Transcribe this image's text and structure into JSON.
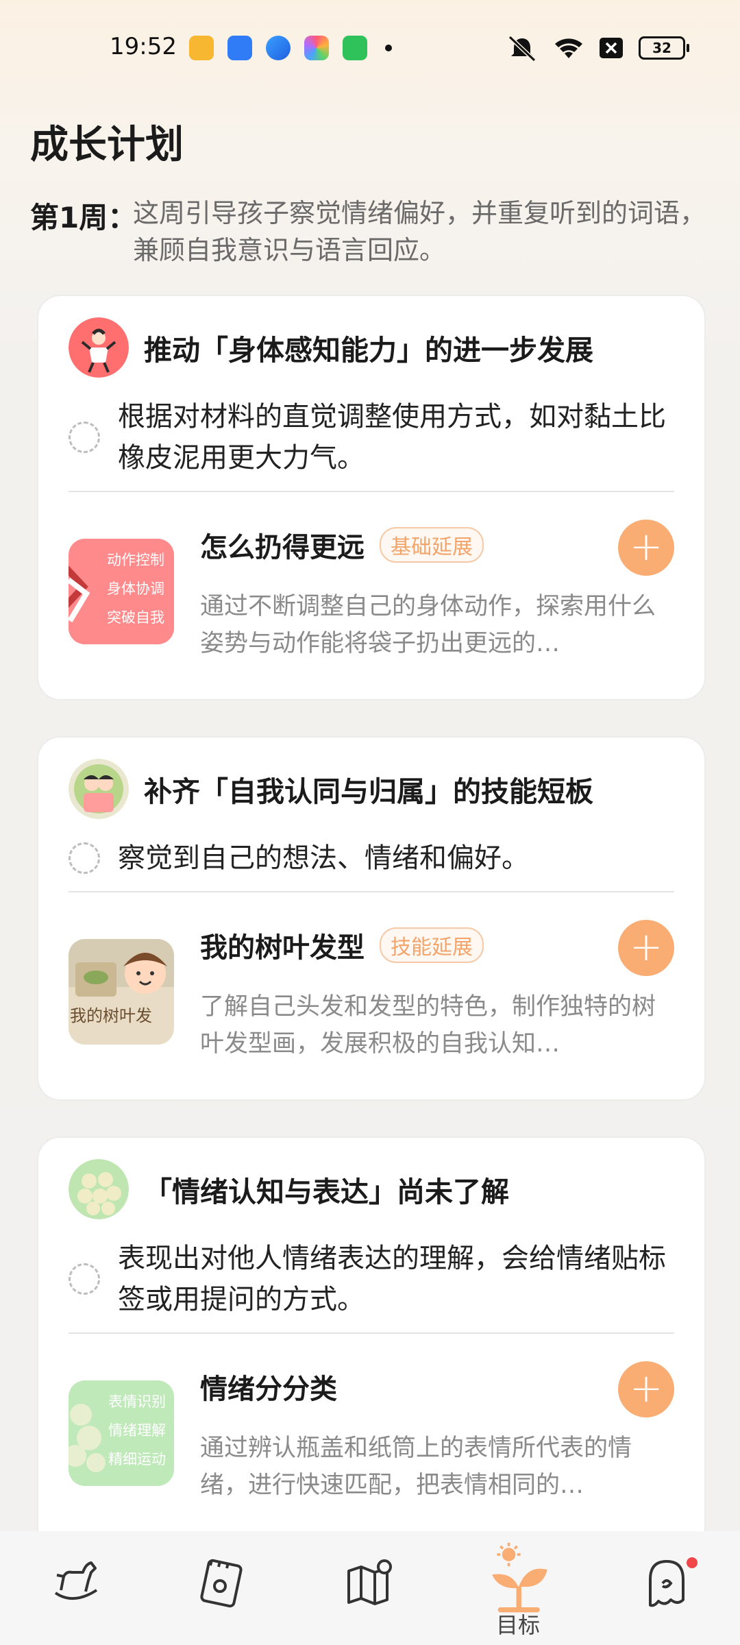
{
  "status_bar": {
    "time": "19:52",
    "battery": "32",
    "notification_icons": [
      "books-app-icon",
      "files-app-icon",
      "browser-app-icon",
      "gallery-app-icon",
      "wechat-app-icon"
    ],
    "system_icons": [
      "silent-icon",
      "wifi-icon",
      "sim-off-icon",
      "battery-icon"
    ]
  },
  "header": {
    "title": "成长计划"
  },
  "week": {
    "label": "第1周：",
    "description": "这周引导孩子察觉情绪偏好，并重复听到的词语，兼顾自我意识与语言回应。"
  },
  "goals": [
    {
      "title": "推动「身体感知能力」的进一步发展",
      "description": "根据对材料的直觉调整使用方式，如对黏土比橡皮泥用更大力气。",
      "activity": {
        "title": "怎么扔得更远",
        "badge": "基础延展",
        "description": "通过不断调整自己的身体动作，探索用什么姿势与动作能将袋子扔出更远的…",
        "thumb_lines": [
          "动作控制",
          "身体协调",
          "突破自我"
        ]
      }
    },
    {
      "title": "补齐「自我认同与归属」的技能短板",
      "description": "察觉到自己的想法、情绪和偏好。",
      "activity": {
        "title": "我的树叶发型",
        "badge": "技能延展",
        "description": "了解自己头发和发型的特色，制作独特的树叶发型画，发展积极的自我认知…",
        "thumb_lines": [
          "我的树叶发"
        ]
      }
    },
    {
      "title": "「情绪认知与表达」尚未了解",
      "description": "表现出对他人情绪表达的理解，会给情绪贴标签或用提问的方式。",
      "activity": {
        "title": "情绪分分类",
        "badge": "",
        "description": "通过辨认瓶盖和纸筒上的表情所代表的情绪，进行快速匹配，把表情相同的…",
        "thumb_lines": [
          "表情识别",
          "情绪理解",
          "精细运动"
        ]
      }
    }
  ],
  "add_label": "+",
  "tabs": [
    {
      "icon": "rocking-horse-icon",
      "label": ""
    },
    {
      "icon": "notebook-icon",
      "label": ""
    },
    {
      "icon": "map-icon",
      "label": ""
    },
    {
      "icon": "sprout-icon",
      "label": "目标"
    },
    {
      "icon": "ghost-profile-icon",
      "label": ""
    }
  ],
  "colors": {
    "accent": "#f9ad73",
    "badge_text": "#f3a46a",
    "notification_dot": "#f0464a"
  }
}
